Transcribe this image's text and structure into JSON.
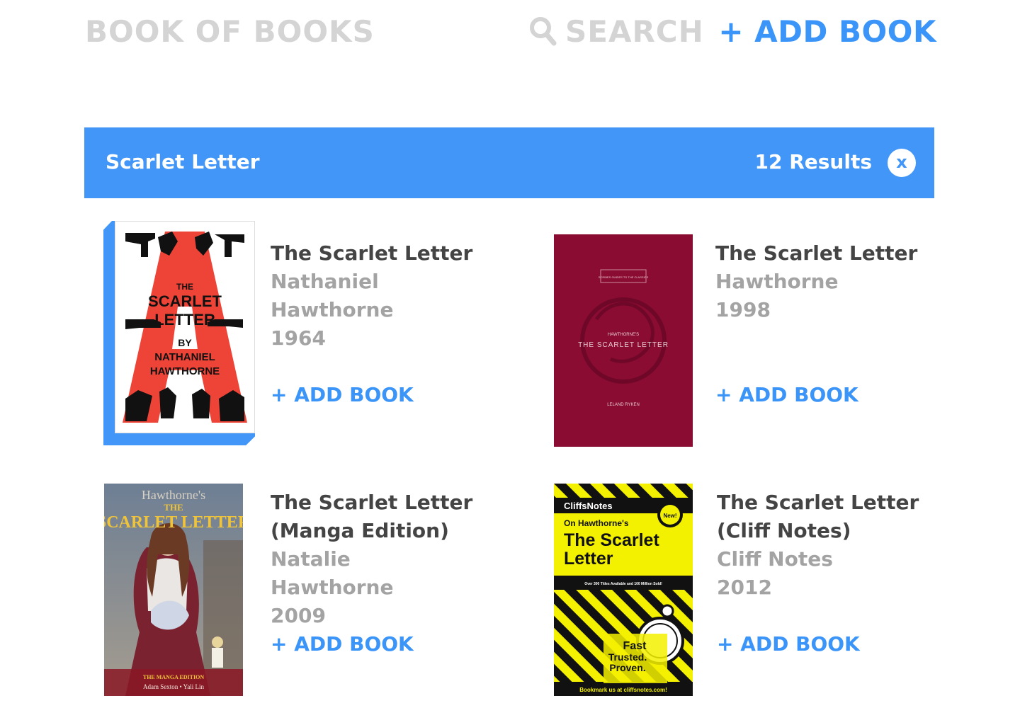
{
  "header": {
    "brand": "BOOK OF BOOKS",
    "search_label": "SEARCH",
    "add_book_label": "+ ADD BOOK"
  },
  "results_bar": {
    "query": "Scarlet Letter",
    "count_label": "12 Results",
    "close_label": "x"
  },
  "colors": {
    "accent": "#4196f7",
    "muted": "#a3a3a3",
    "brand_text": "#d4d4d4",
    "title_text": "#444444"
  },
  "results": [
    {
      "title": "The Scarlet Letter",
      "author": "Nathaniel Hawthorne",
      "year": "1964",
      "add_label": "+ ADD BOOK",
      "selected": true,
      "cover": {
        "top": "THE",
        "mid1": "SCARLET",
        "mid2": "LETTER",
        "by": "BY",
        "author1": "NATHANIEL",
        "author2": "HAWTHORNE"
      }
    },
    {
      "title": "The Scarlet Letter",
      "author": "Hawthorne",
      "year": "1998",
      "add_label": "+ ADD BOOK",
      "selected": false,
      "cover": {
        "series": "SCRIBES GUIDES TO THE CLASSICS",
        "small": "HAWTHORNE'S",
        "main": "THE SCARLET LETTER",
        "author": "LELAND RYKEN"
      }
    },
    {
      "title": "The Scarlet Letter (Manga Edition)",
      "author": "Natalie Hawthorne",
      "year": "2009",
      "add_label": "+ ADD BOOK",
      "selected": false,
      "cover": {
        "top": "Hawthorne's",
        "the": "THE",
        "main": "SCARLET LETTER",
        "edition": "THE MANGA EDITION",
        "credits": "Adam Sexton • Yali Lin"
      }
    },
    {
      "title": "The Scarlet Letter (Cliff Notes)",
      "author": "Cliff Notes",
      "year": "2012",
      "add_label": "+ ADD BOOK",
      "selected": false,
      "cover": {
        "brand": "CliffsNotes",
        "badge": "New!",
        "on": "On Hawthorne's",
        "main1": "The Scarlet",
        "main2": "Letter",
        "stats": "Over 300 Titles Available and 100 Million Sold!",
        "slogan1": "Fast",
        "slogan2": "Trusted.",
        "slogan3": "Proven.",
        "footer": "Bookmark us at cliffsnotes.com!"
      }
    }
  ]
}
